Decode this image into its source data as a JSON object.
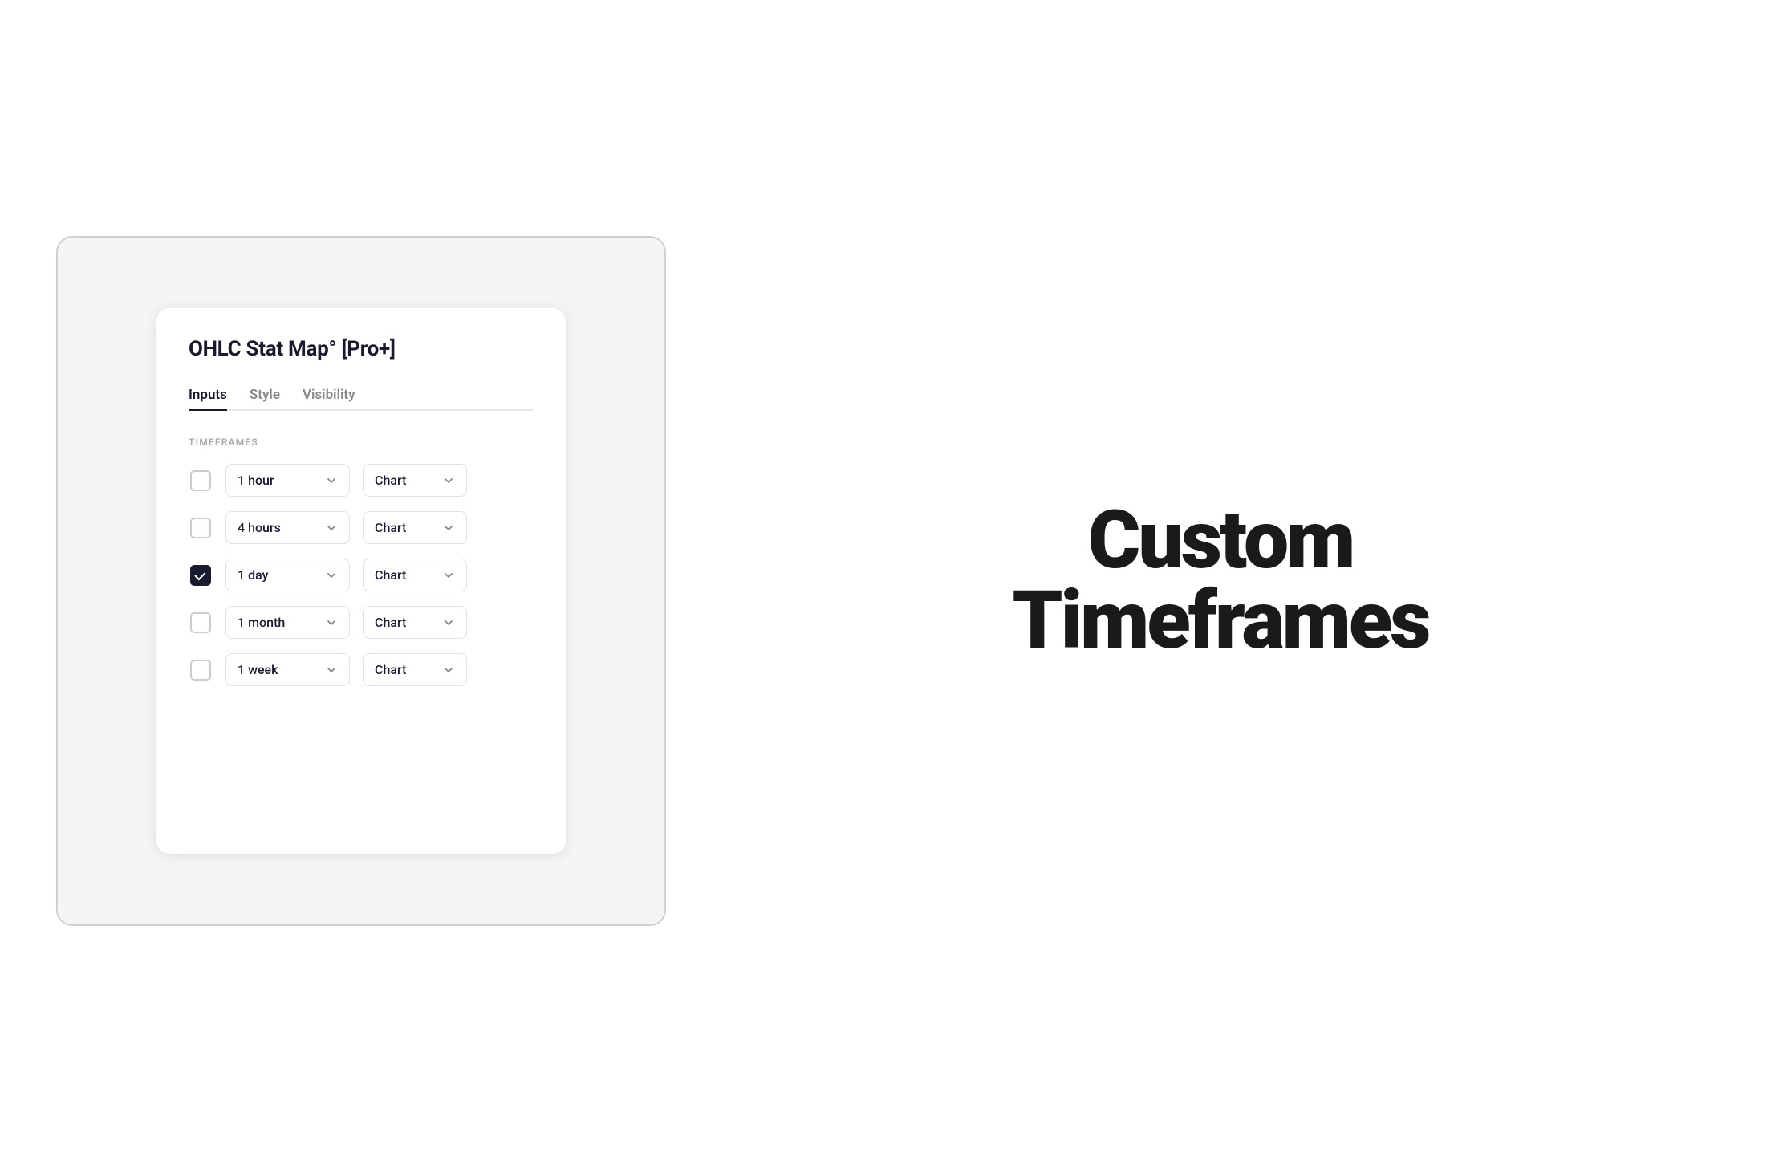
{
  "app": {
    "title": "OHLC Stat Map° [Pro+]",
    "tabs": [
      {
        "id": "inputs",
        "label": "Inputs",
        "active": true
      },
      {
        "id": "style",
        "label": "Style",
        "active": false
      },
      {
        "id": "visibility",
        "label": "Visibility",
        "active": false
      }
    ]
  },
  "section": {
    "timeframes_label": "TIMEFRAMES"
  },
  "timeframe_rows": [
    {
      "id": "row1",
      "checked": false,
      "timeframe_value": "1 hour",
      "chart_value": "Chart"
    },
    {
      "id": "row2",
      "checked": false,
      "timeframe_value": "4 hours",
      "chart_value": "Chart"
    },
    {
      "id": "row3",
      "checked": true,
      "timeframe_value": "1 day",
      "chart_value": "Chart"
    },
    {
      "id": "row4",
      "checked": false,
      "timeframe_value": "1 month",
      "chart_value": "Chart"
    },
    {
      "id": "row5",
      "checked": false,
      "timeframe_value": "1 week",
      "chart_value": "Chart"
    }
  ],
  "hero": {
    "line1": "Custom",
    "line2": "Timeframes"
  },
  "colors": {
    "checked_bg": "#1a1a2e",
    "tab_active_border": "#1a1a2e"
  }
}
